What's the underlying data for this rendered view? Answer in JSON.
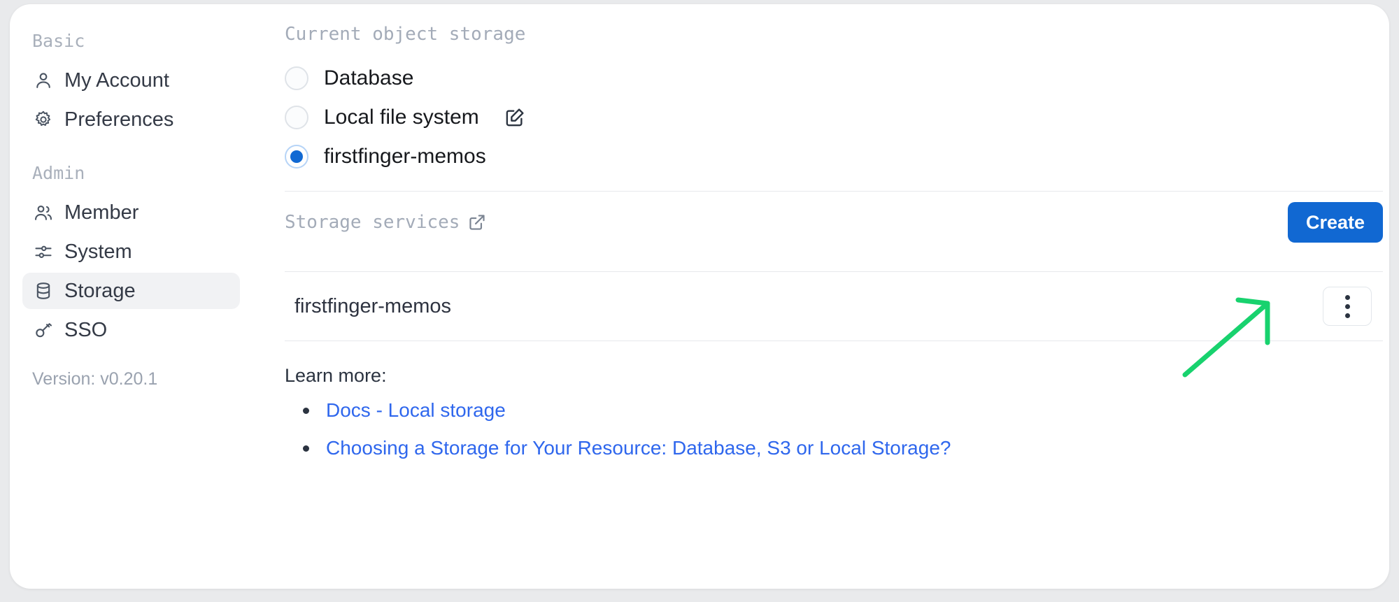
{
  "sidebar": {
    "sections": [
      {
        "title": "Basic",
        "items": [
          {
            "label": "My Account",
            "icon": "user-icon"
          },
          {
            "label": "Preferences",
            "icon": "gear-icon"
          }
        ]
      },
      {
        "title": "Admin",
        "items": [
          {
            "label": "Member",
            "icon": "users-icon"
          },
          {
            "label": "System",
            "icon": "sliders-icon"
          },
          {
            "label": "Storage",
            "icon": "database-icon"
          },
          {
            "label": "SSO",
            "icon": "key-icon"
          }
        ]
      }
    ],
    "version": "Version: v0.20.1"
  },
  "main": {
    "current_storage": {
      "title": "Current object storage",
      "options": [
        {
          "label": "Database",
          "selected": false,
          "has_edit_icon": false
        },
        {
          "label": "Local file system",
          "selected": false,
          "has_edit_icon": true
        },
        {
          "label": "firstfinger-memos",
          "selected": true,
          "has_edit_icon": false
        }
      ],
      "edit_icon": "edit-square-pencil-icon"
    },
    "storage_services": {
      "title": "Storage services",
      "external_link_icon": "external-link-icon",
      "create_label": "Create",
      "rows": [
        {
          "name": "firstfinger-memos",
          "menu_icon": "more-vertical-icon"
        }
      ]
    },
    "learn_more": {
      "title": "Learn more:",
      "links": [
        "Docs - Local storage",
        "Choosing a Storage for Your Resource: Database, S3 or Local Storage?"
      ]
    }
  },
  "annotation": {
    "arrow_color": "#18d26e",
    "points_to": "Create"
  },
  "colors": {
    "accent_blue": "#1168d2",
    "link_blue": "#2f67ed",
    "muted_text": "#a3abb8",
    "body_text": "#2b3340",
    "active_nav_bg": "#f1f2f4",
    "divider": "#e7e9ec",
    "page_bg": "#e9eaec",
    "card_bg": "#ffffff"
  }
}
